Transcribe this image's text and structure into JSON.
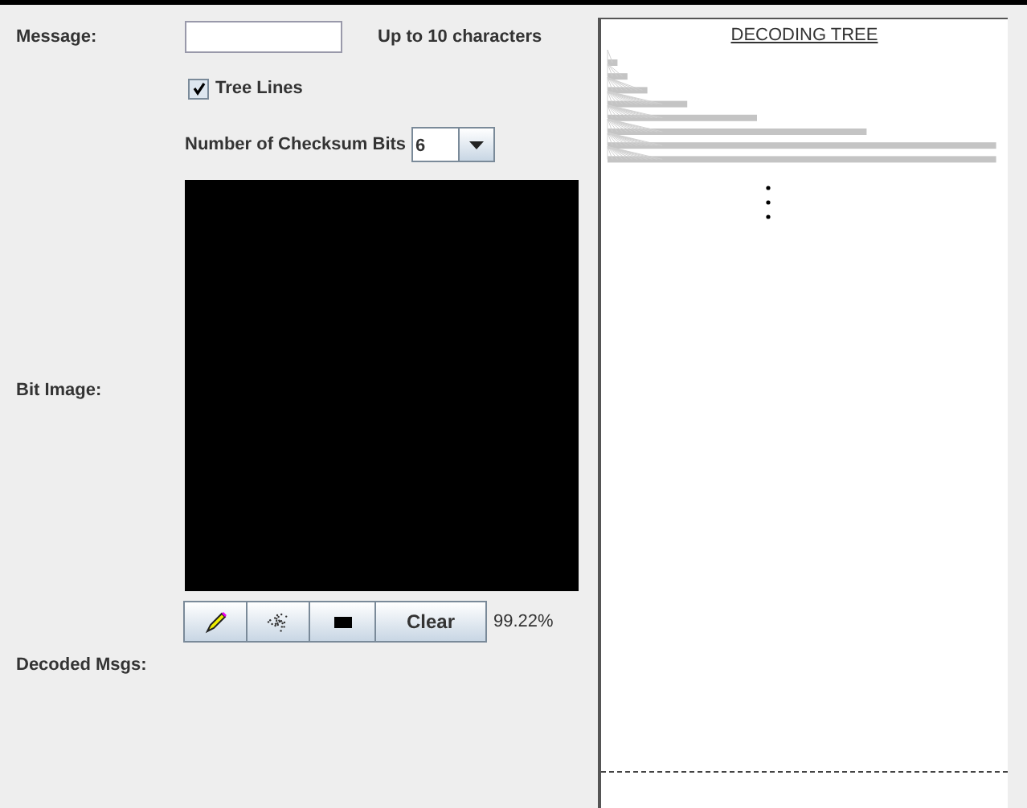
{
  "message": {
    "label": "Message:",
    "hint": "Up to 10 characters"
  },
  "tree_lines": {
    "label": "Tree Lines",
    "checked": true
  },
  "checksum": {
    "label": "Number of Checksum Bits",
    "value": "6"
  },
  "bit_image": {
    "label": "Bit Image:"
  },
  "tools": [
    {
      "kind": "pencil"
    },
    {
      "kind": "spray"
    },
    {
      "kind": "fill"
    },
    {
      "kind": "text",
      "label": "Clear"
    }
  ],
  "percent": "99.22%",
  "decoded": {
    "label": "Decoded Msgs:"
  },
  "tree": {
    "title": "DECODING TREE"
  }
}
